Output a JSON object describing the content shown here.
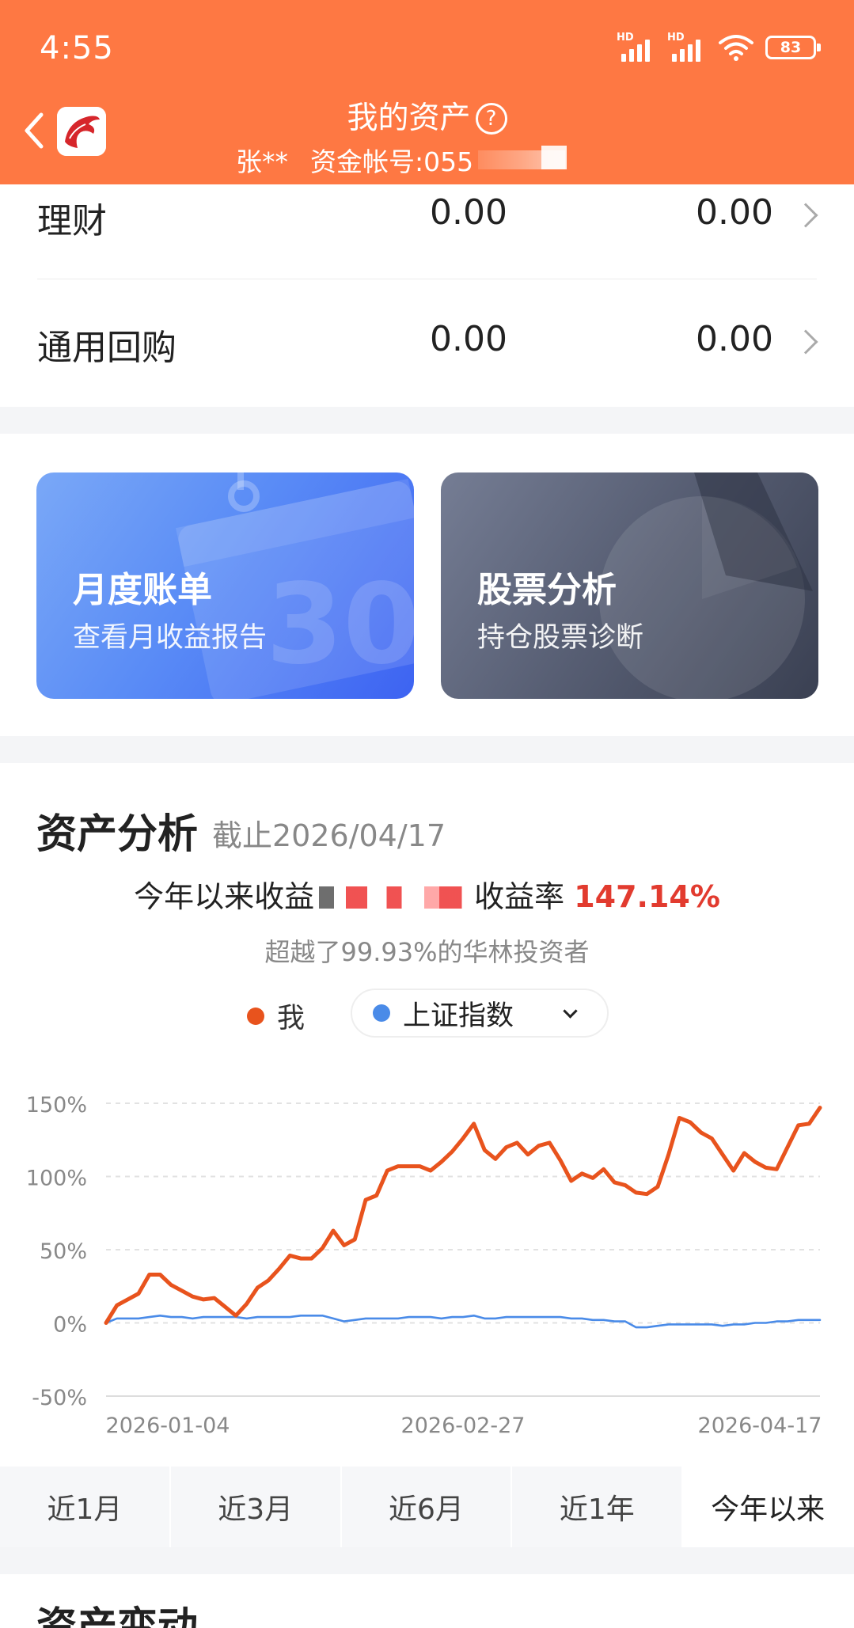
{
  "status_bar": {
    "time": "4:55",
    "signal_label_1": "HD",
    "signal_label_2": "HD",
    "battery": "83"
  },
  "header": {
    "title": "我的资产",
    "help": "?",
    "account_name": "张**",
    "account_label": "资金帐号:055"
  },
  "asset_rows": [
    {
      "label": "理财",
      "value1": "0.00",
      "value2": "0.00"
    },
    {
      "label": "通用回购",
      "value1": "0.00",
      "value2": "0.00"
    }
  ],
  "cards": [
    {
      "title": "月度账单",
      "subtitle": "查看月收益报告",
      "decoration": "30"
    },
    {
      "title": "股票分析",
      "subtitle": "持仓股票诊断"
    }
  ],
  "analysis": {
    "title": "资产分析",
    "as_of": "截止2026/04/17",
    "ytd_label": "今年以来收益",
    "rate_label": "收益率",
    "rate_value": "147.14%",
    "beat_text": "超越了99.93%的华林投资者",
    "legend_me": "我",
    "index_name": "上证指数"
  },
  "colors": {
    "header": "#FE7843",
    "me_line": "#E8531D",
    "index_line": "#4A8BE8",
    "rate": "#E23B2F"
  },
  "chart_data": {
    "type": "line",
    "x": [
      "2026-01-04",
      "2026-02-27",
      "2026-04-17"
    ],
    "yticks": [
      "150%",
      "100%",
      "50%",
      "0%",
      "-50%"
    ],
    "ylim": [
      -50,
      150
    ],
    "grid": true,
    "series": [
      {
        "name": "我",
        "values": [
          0,
          12,
          16,
          20,
          33,
          33,
          26,
          22,
          18,
          16,
          17,
          11,
          5,
          13,
          24,
          29,
          37,
          46,
          44,
          44,
          51,
          63,
          53,
          57,
          84,
          87,
          104,
          107,
          107,
          107,
          104,
          110,
          117,
          126,
          136,
          118,
          112,
          120,
          123,
          115,
          121,
          123,
          111,
          97,
          102,
          99,
          105,
          96,
          94,
          89,
          88,
          93,
          115,
          140,
          137,
          130,
          126,
          115,
          104,
          116,
          110,
          106,
          105,
          120,
          135,
          136,
          147
        ]
      },
      {
        "name": "上证指数",
        "values": [
          0,
          3,
          3,
          3,
          4,
          5,
          4,
          4,
          3,
          4,
          4,
          4,
          4,
          3,
          4,
          4,
          4,
          4,
          5,
          5,
          5,
          3,
          1,
          2,
          3,
          3,
          3,
          3,
          4,
          4,
          4,
          3,
          4,
          4,
          5,
          3,
          3,
          4,
          4,
          4,
          4,
          4,
          4,
          3,
          3,
          2,
          2,
          1,
          1,
          -3,
          -3,
          -2,
          -1,
          -1,
          -1,
          -1,
          -1,
          -2,
          -1,
          -1,
          0,
          0,
          1,
          1,
          2,
          2,
          2
        ]
      }
    ]
  },
  "tabs": [
    {
      "label": "近1月",
      "active": false
    },
    {
      "label": "近3月",
      "active": false
    },
    {
      "label": "近6月",
      "active": false
    },
    {
      "label": "近1年",
      "active": false
    },
    {
      "label": "今年以来",
      "active": true
    }
  ],
  "next_section": {
    "title": "资产变动"
  }
}
